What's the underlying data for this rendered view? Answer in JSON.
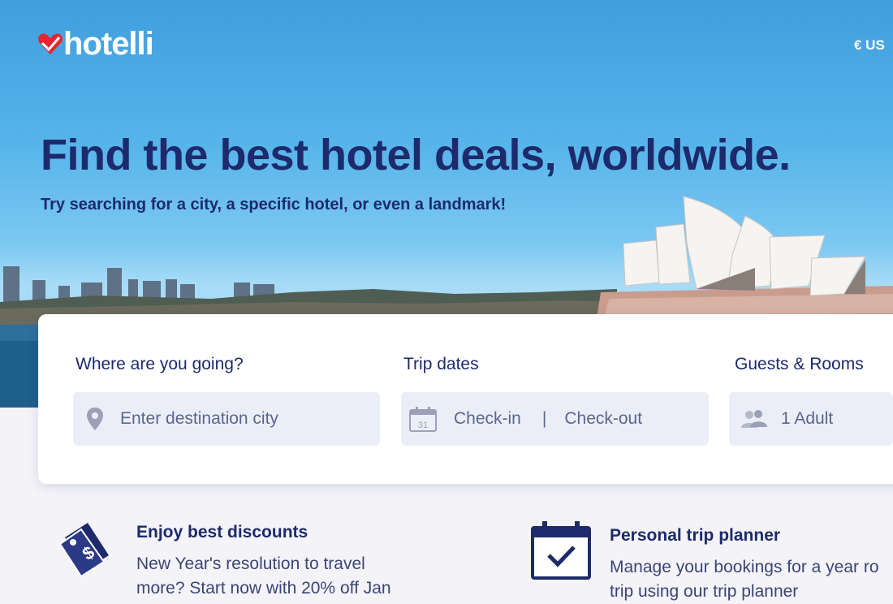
{
  "header": {
    "logo_text": "hotelli",
    "currency": "€ US"
  },
  "hero": {
    "headline": "Find the best hotel deals, worldwide.",
    "subhead": "Try searching for a city, a specific hotel, or even a landmark!"
  },
  "search": {
    "destination_label": "Where are you going?",
    "destination_placeholder": "Enter destination city",
    "dates_label": "Trip dates",
    "checkin": "Check-in",
    "separator": "|",
    "checkout": "Check-out",
    "calendar_day": "31",
    "guests_label": "Guests & Rooms",
    "guests_value": "1 Adult"
  },
  "features": [
    {
      "title": "Enjoy best discounts",
      "lines": [
        "New Year's resolution to travel",
        "more? Start now with 20% off Jan"
      ],
      "icon": "price-tag-icon"
    },
    {
      "title": "Personal trip planner",
      "lines": [
        "Manage your bookings for a year ro",
        "trip using our trip planner"
      ],
      "icon": "calendar-check-icon"
    }
  ],
  "colors": {
    "brand_red": "#e3262f",
    "navy": "#1d2a6b",
    "field_bg": "#eceef7"
  }
}
